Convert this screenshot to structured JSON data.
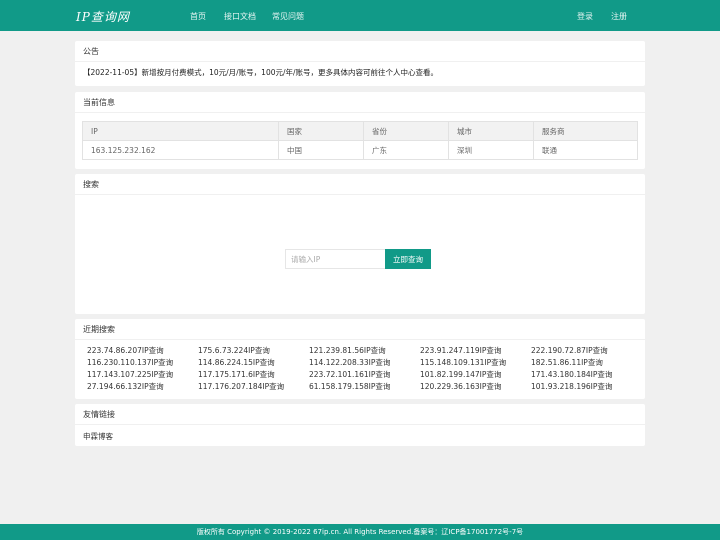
{
  "header": {
    "logo": "IP查询网",
    "nav": [
      "首页",
      "接口文档",
      "常见问题"
    ],
    "login": "登录",
    "register": "注册"
  },
  "notice": {
    "title": "公告",
    "text": "【2022-11-05】新增按月付费模式，10元/月/账号，100元/年/账号，更多具体内容可前往个人中心查看。"
  },
  "current": {
    "title": "当前信息",
    "headers": [
      "IP",
      "国家",
      "省份",
      "城市",
      "服务商"
    ],
    "row": [
      "163.125.232.162",
      "中国",
      "广东",
      "深圳",
      "联通"
    ]
  },
  "search": {
    "title": "搜索",
    "placeholder": "请输入IP",
    "button": "立即查询"
  },
  "recent": {
    "title": "近期搜索",
    "items": [
      "223.74.86.207IP查询",
      "175.6.73.224IP查询",
      "121.239.81.56IP查询",
      "223.91.247.119IP查询",
      "222.190.72.87IP查询",
      "116.230.110.137IP查询",
      "114.86.224.15IP查询",
      "114.122.208.33IP查询",
      "115.148.109.131IP查询",
      "182.51.86.11IP查询",
      "117.143.107.225IP查询",
      "117.175.171.6IP查询",
      "223.72.101.161IP查询",
      "101.82.199.147IP查询",
      "171.43.180.184IP查询",
      "27.194.66.132IP查询",
      "117.176.207.184IP查询",
      "61.158.179.158IP查询",
      "120.229.36.163IP查询",
      "101.93.218.196IP查询"
    ]
  },
  "links": {
    "title": "友情链接",
    "items": [
      "申霖博客"
    ]
  },
  "footer": {
    "text": "版权所有 Copyright © 2019-2022 67ip.cn. All Rights Reserved.备案号：辽ICP备17001772号-7号"
  },
  "colors": {
    "brand": "#119a88",
    "background": "#f0f0f0"
  }
}
